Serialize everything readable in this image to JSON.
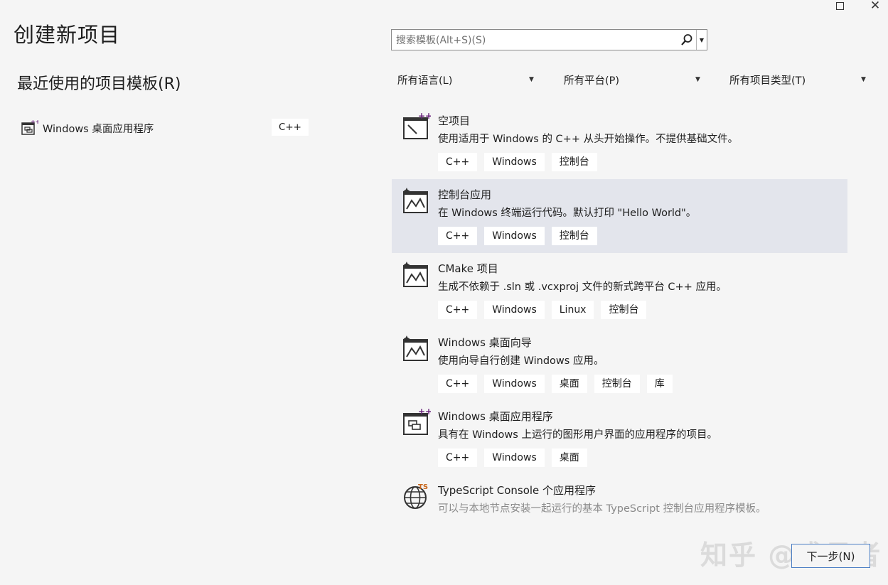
{
  "window": {
    "maximize_icon": "maximize-icon",
    "close_label": "✕"
  },
  "page_title": "创建新项目",
  "recent": {
    "title": "最近使用的项目模板(R)",
    "items": [
      {
        "label": "Windows 桌面应用程序",
        "tag": "C++",
        "icon": "windows-desktop-app-icon"
      }
    ]
  },
  "search": {
    "placeholder": "搜索模板(Alt+S)(S)",
    "icon": "search-icon"
  },
  "filters": {
    "language": "所有语言(L)",
    "platform": "所有平台(P)",
    "project_type": "所有项目类型(T)"
  },
  "templates": [
    {
      "name": "空项目",
      "desc": "使用适用于 Windows 的 C++ 从头开始操作。不提供基础文件。",
      "tags": [
        "C++",
        "Windows",
        "控制台"
      ],
      "icon": "empty-project-icon",
      "selected": false
    },
    {
      "name": "控制台应用",
      "desc": "在 Windows 终端运行代码。默认打印 \"Hello World\"。",
      "tags": [
        "C++",
        "Windows",
        "控制台"
      ],
      "icon": "console-app-icon",
      "selected": true
    },
    {
      "name": "CMake 项目",
      "desc": "生成不依赖于 .sln 或 .vcxproj 文件的新式跨平台 C++ 应用。",
      "tags": [
        "C++",
        "Windows",
        "Linux",
        "控制台"
      ],
      "icon": "cmake-project-icon",
      "selected": false
    },
    {
      "name": "Windows 桌面向导",
      "desc": "使用向导自行创建 Windows 应用。",
      "tags": [
        "C++",
        "Windows",
        "桌面",
        "控制台",
        "库"
      ],
      "icon": "desktop-wizard-icon",
      "selected": false
    },
    {
      "name": "Windows 桌面应用程序",
      "desc": "具有在 Windows 上运行的图形用户界面的应用程序的项目。",
      "tags": [
        "C++",
        "Windows",
        "桌面"
      ],
      "icon": "windows-desktop-app-icon",
      "selected": false
    },
    {
      "name": "TypeScript Console 个应用程序",
      "desc": "可以与本地节点安装一起运行的基本 TypeScript 控制台应用程序模板。",
      "tags": [],
      "icon": "typescript-globe-icon",
      "selected": false,
      "dim": true
    }
  ],
  "next_button": "下一步(N)",
  "watermark": "知乎 @盛见者",
  "colors": {
    "background": "#f5f5f5",
    "selected_row": "#e3e5ec",
    "accent_border": "#4c7fc4",
    "icon_purple": "#68217a"
  }
}
